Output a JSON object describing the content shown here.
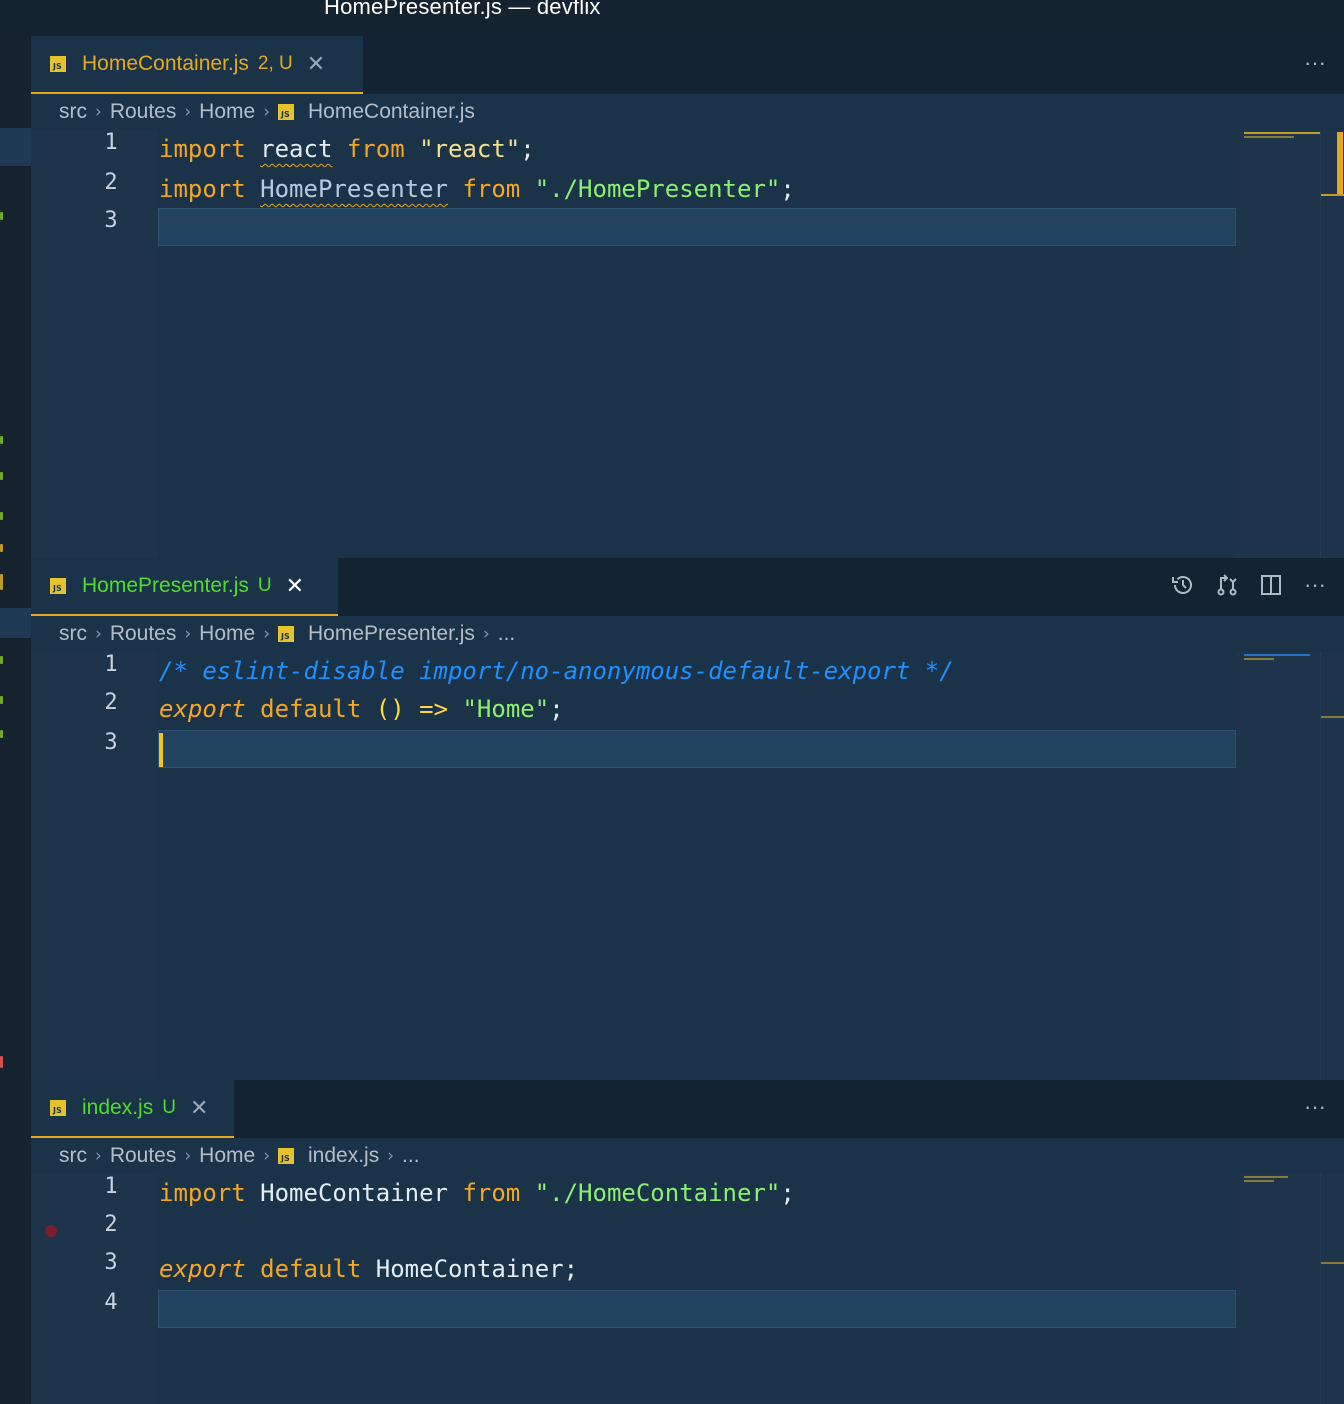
{
  "window": {
    "title": "HomePresenter.js — devflix"
  },
  "groups": [
    {
      "tab": {
        "icon": "javascript-file-icon",
        "name": "HomeContainer.js",
        "badge": "2, U",
        "close": "✕",
        "name_color": "#e5a920",
        "badge_color": "#e5a920"
      },
      "actions": [
        "more-actions"
      ],
      "breadcrumb": {
        "parts": [
          "src",
          "Routes",
          "Home"
        ],
        "file": "HomeContainer.js",
        "trailing": ""
      },
      "line_numbers": [
        "1",
        "2",
        "3"
      ],
      "code": [
        {
          "t1": "import",
          "t2": "react",
          "t3": "from",
          "t4": "\"react\"",
          "t5": ";"
        },
        {
          "t1": "import",
          "t2": "HomePresenter",
          "t3": "from",
          "t4": "\"./HomePresenter\"",
          "t5": ";"
        }
      ]
    },
    {
      "tab": {
        "icon": "javascript-file-icon",
        "name": "HomePresenter.js",
        "badge": "U",
        "close": "✕",
        "name_color": "#4fdc2e",
        "badge_color": "#4fdc2e"
      },
      "actions": [
        "timeline-history",
        "open-changes",
        "split-editor",
        "more-actions"
      ],
      "breadcrumb": {
        "parts": [
          "src",
          "Routes",
          "Home"
        ],
        "file": "HomePresenter.js",
        "trailing": "..."
      },
      "line_numbers": [
        "1",
        "2",
        "3"
      ],
      "code": [
        {
          "comment": "/* eslint-disable import/no-anonymous-default-export */"
        },
        {
          "t1": "export",
          "t2": "default",
          "t3": "()",
          "t4": "=>",
          "t5": "\"Home\"",
          "t6": ";"
        }
      ]
    },
    {
      "tab": {
        "icon": "javascript-file-icon",
        "name": "index.js",
        "badge": "U",
        "close": "✕",
        "name_color": "#4fdc2e",
        "badge_color": "#4fdc2e"
      },
      "actions": [
        "more-actions"
      ],
      "breadcrumb": {
        "parts": [
          "src",
          "Routes",
          "Home"
        ],
        "file": "index.js",
        "trailing": "..."
      },
      "line_numbers": [
        "1",
        "2",
        "3",
        "4"
      ],
      "code": [
        {
          "t1": "import",
          "t2": "HomeContainer",
          "t3": "from",
          "t4": "\"./HomeContainer\"",
          "t5": ";"
        },
        {
          "t1": "export",
          "t2": "default",
          "t3": "HomeContainer",
          "t4": ";"
        }
      ]
    }
  ],
  "icons": {
    "js": "JS",
    "more": "···",
    "chevron": "›"
  },
  "colors": {
    "editor_bg": "#1b3349",
    "tab_bg": "#142331",
    "accent": "#e5a920",
    "keyword": "#f5a623",
    "string": "#8cf06e",
    "comment": "#1e90ff"
  }
}
